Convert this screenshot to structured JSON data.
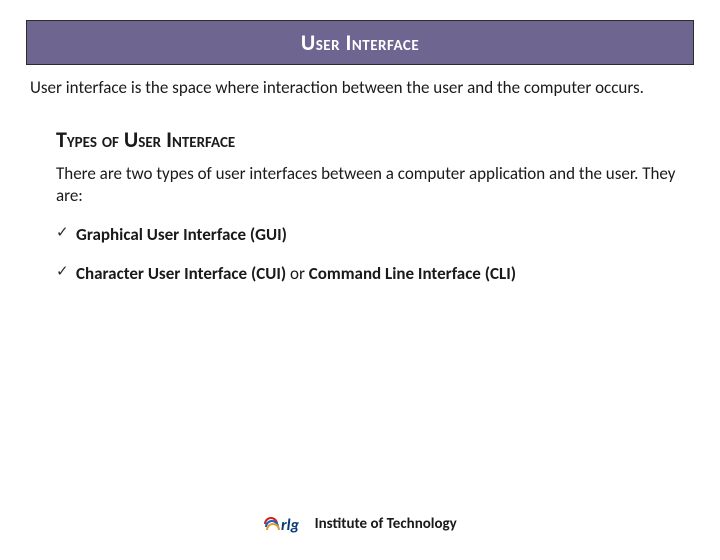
{
  "title": "User Interface",
  "intro": "User interface is the space where interaction between the user and the computer occurs.",
  "subheading": "Types of User Interface",
  "body": "There are two types of user interfaces between a computer application and the user. They are:",
  "items": [
    {
      "bold": "Graphical User Interface (GUI)",
      "rest": ""
    },
    {
      "bold": "Character User Interface  (CUI)",
      "rest": " or ",
      "bold2": "Command Line Interface (CLI)"
    }
  ],
  "footer": {
    "logo_text": "rlg",
    "org": "Institute of Technology"
  }
}
